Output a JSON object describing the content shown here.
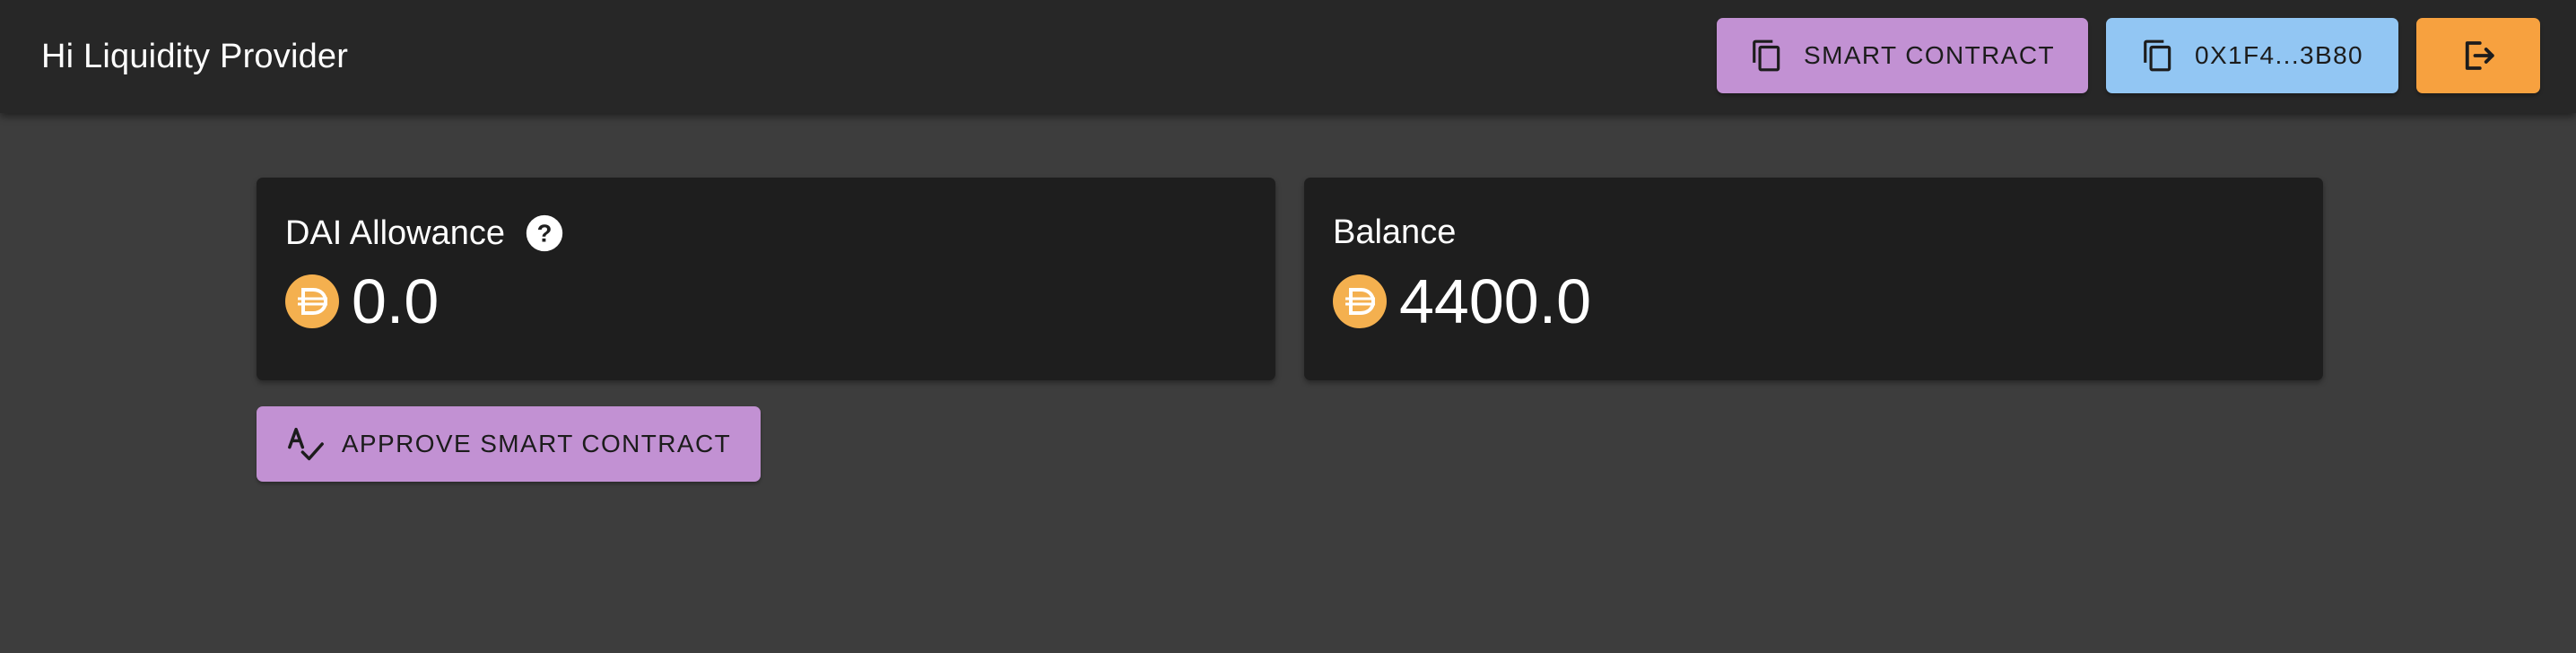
{
  "header": {
    "title": "Hi Liquidity Provider",
    "smart_contract_label": "SMART CONTRACT",
    "address_label": "0X1F4...3B80",
    "logout_icon": "logout-icon"
  },
  "cards": {
    "allowance": {
      "title": "DAI Allowance",
      "amount": "0.0",
      "help_icon": "help-icon",
      "token_icon": "dai-icon"
    },
    "balance": {
      "title": "Balance",
      "amount": "4400.0",
      "token_icon": "dai-icon"
    }
  },
  "actions": {
    "approve_label": "APPROVE SMART CONTRACT",
    "approve_icon": "spellcheck-icon"
  },
  "colors": {
    "background": "#3d3d3d",
    "appbar": "#272727",
    "card": "#1e1e1e",
    "purple": "#c291d3",
    "blue": "#92c6f3",
    "orange": "#f7a13f",
    "dai": "#f4b04f"
  }
}
